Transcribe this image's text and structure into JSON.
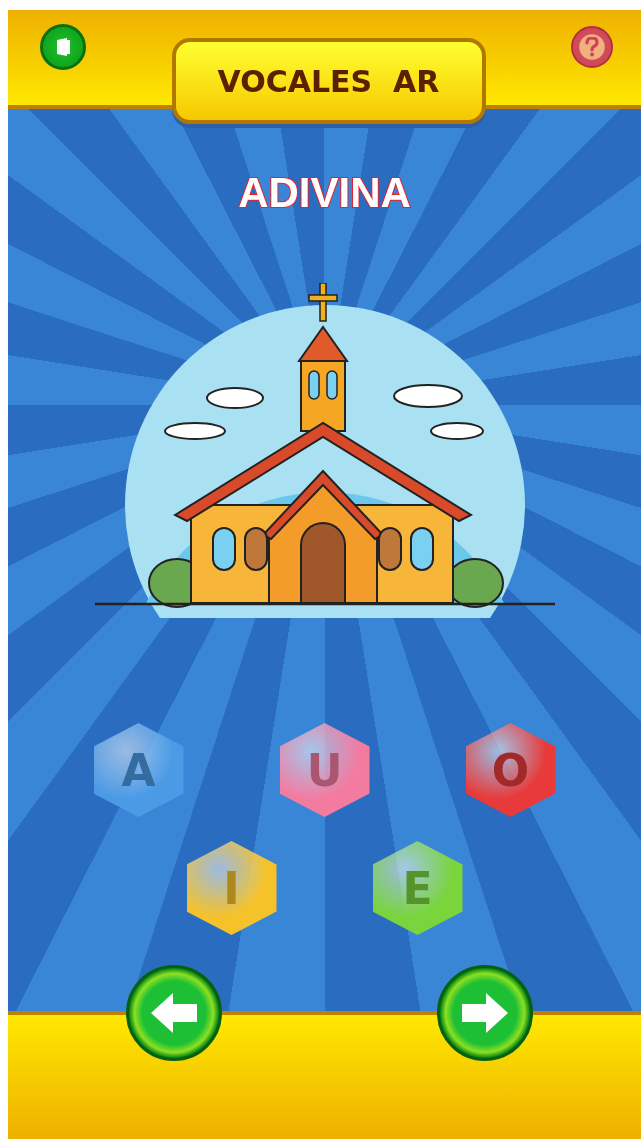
{
  "header": {
    "title": "VOCALES  AR"
  },
  "prompt": "ADIVINA",
  "vowels": [
    {
      "letter": "A",
      "color": "#4a9ae6"
    },
    {
      "letter": "U",
      "color": "#f47ba0"
    },
    {
      "letter": "O",
      "color": "#e83a3a"
    },
    {
      "letter": "I",
      "color": "#f5c22a"
    },
    {
      "letter": "E",
      "color": "#7ad43c"
    }
  ]
}
